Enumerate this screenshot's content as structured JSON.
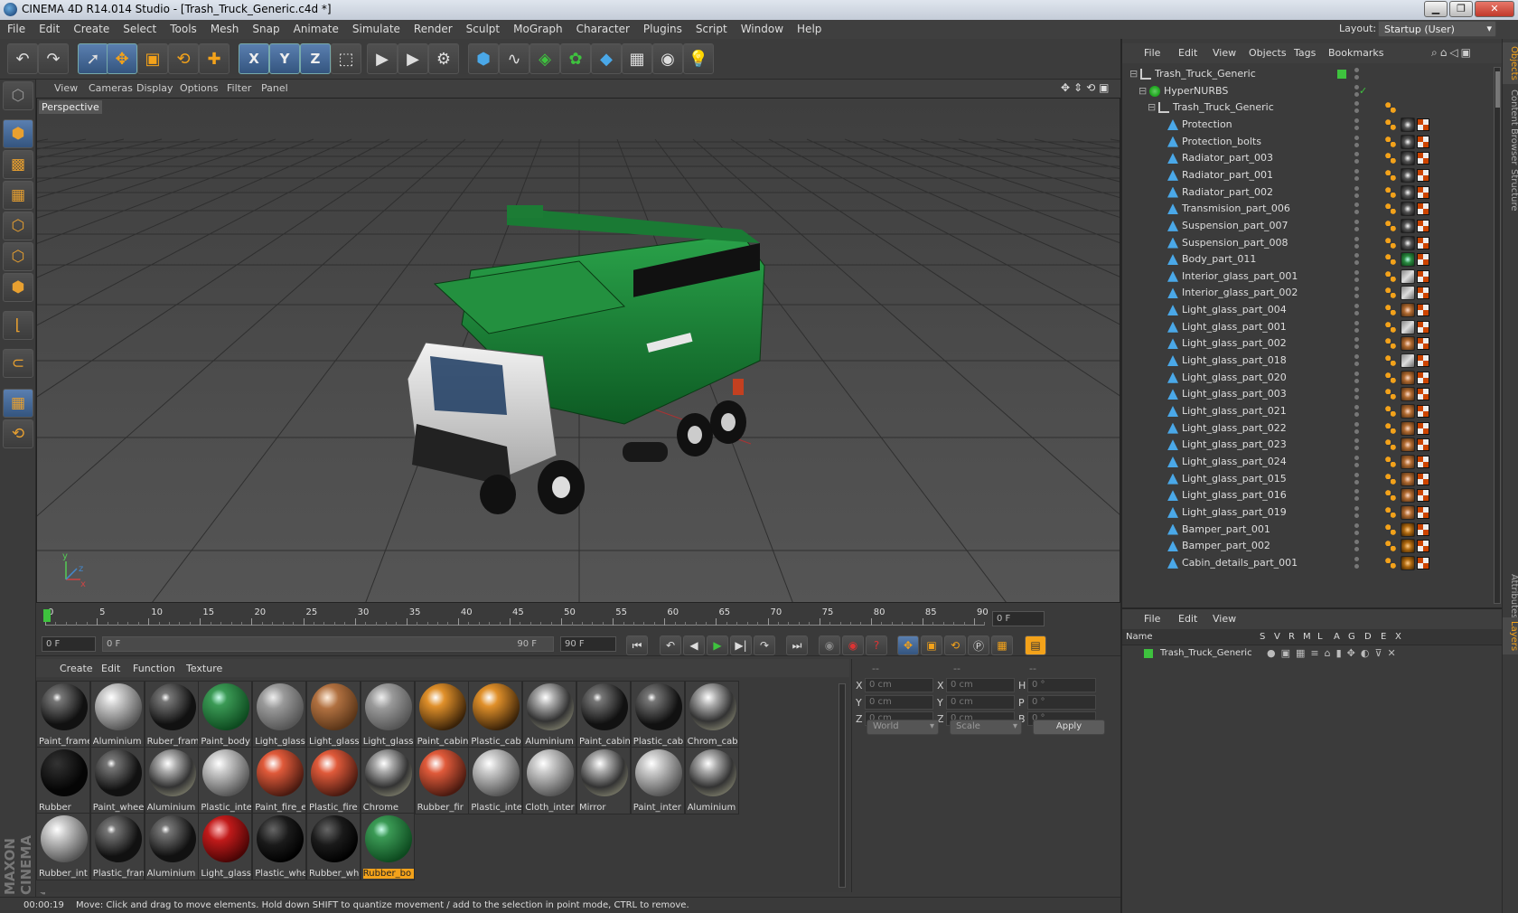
{
  "window": {
    "title": "CINEMA 4D R14.014 Studio - [Trash_Truck_Generic.c4d *]",
    "minimize": "▁",
    "maximize": "❐",
    "close": "✕"
  },
  "menubar": [
    "File",
    "Edit",
    "Create",
    "Select",
    "Tools",
    "Mesh",
    "Snap",
    "Animate",
    "Simulate",
    "Render",
    "Sculpt",
    "MoGraph",
    "Character",
    "Plugins",
    "Script",
    "Window",
    "Help"
  ],
  "layout": {
    "label": "Layout:",
    "value": "Startup (User)"
  },
  "toolbar": {
    "icons": [
      "undo-icon",
      "redo-icon",
      "live-selection-icon",
      "move-icon",
      "scale-icon",
      "rotate-icon",
      "recent-tool-icon",
      "x-axis-icon",
      "y-axis-icon",
      "z-axis-icon",
      "coordinate-system-icon",
      "render-view-icon",
      "render-picture-viewer-icon",
      "render-settings-icon",
      "cube-icon",
      "spline-icon",
      "nurbs-icon",
      "array-icon",
      "deformer-icon",
      "floor-icon",
      "camera-icon",
      "light-icon"
    ],
    "axis_labels": [
      "X",
      "Y",
      "Z"
    ]
  },
  "left_tools": [
    "make-editable-icon",
    "model-mode-icon",
    "texture-mode-icon",
    "workplane-mode-icon",
    "points-mode-icon",
    "edges-mode-icon",
    "polygons-mode-icon",
    "enable-axis-icon",
    "tweak-icon",
    "snap-icon",
    "lock-workplane-icon"
  ],
  "brand": "MAXON CINEMA 4D",
  "viewport": {
    "menu": [
      "View",
      "Cameras",
      "Display",
      "Options",
      "Filter",
      "Panel"
    ],
    "label": "Perspective",
    "axis_letters": {
      "x": "x",
      "y": "y",
      "z": "z"
    }
  },
  "timeline": {
    "ticks": [
      "0",
      "5",
      "10",
      "15",
      "20",
      "25",
      "30",
      "35",
      "40",
      "45",
      "50",
      "55",
      "60",
      "65",
      "70",
      "75",
      "80",
      "85",
      "90"
    ],
    "current_frame": "0 F",
    "start": "0 F",
    "range_start": "0 F",
    "range_end": "90 F",
    "end": "90 F"
  },
  "material_panel": {
    "menu": [
      "Create",
      "Edit",
      "Function",
      "Texture"
    ],
    "materials": [
      {
        "name": "Paint_frame",
        "style": "checker-dark"
      },
      {
        "name": "Aluminium",
        "style": "checker-light"
      },
      {
        "name": "Ruber_frame",
        "style": "checker-dark"
      },
      {
        "name": "Paint_body",
        "style": "green"
      },
      {
        "name": "Light_glass",
        "style": "glass"
      },
      {
        "name": "Light_glass",
        "style": "amber"
      },
      {
        "name": "Light_glass",
        "style": "glass"
      },
      {
        "name": "Paint_cabin",
        "style": "orange-checker"
      },
      {
        "name": "Plastic_cab",
        "style": "orange-checker"
      },
      {
        "name": "Aluminium",
        "style": "chrome"
      },
      {
        "name": "Paint_cabin",
        "style": "checker-dark"
      },
      {
        "name": "Plastic_cab",
        "style": "checker-dark"
      },
      {
        "name": "Chrom_cab",
        "style": "chrome"
      },
      {
        "name": "Rubber",
        "style": "black"
      },
      {
        "name": "Paint_wheel",
        "style": "checker-dark"
      },
      {
        "name": "Aluminium",
        "style": "chrome"
      },
      {
        "name": "Plastic_inte",
        "style": "checker-light"
      },
      {
        "name": "Paint_fire_e",
        "style": "red-checker"
      },
      {
        "name": "Plastic_fire",
        "style": "red-checker"
      },
      {
        "name": "Chrome",
        "style": "chrome"
      },
      {
        "name": "Rubber_fir",
        "style": "red-checker"
      },
      {
        "name": "Plastic_inte",
        "style": "checker-light"
      },
      {
        "name": "Cloth_inter",
        "style": "checker-light"
      },
      {
        "name": "Mirror",
        "style": "chrome"
      },
      {
        "name": "Paint_inter",
        "style": "checker-light"
      },
      {
        "name": "Aluminium",
        "style": "chrome"
      },
      {
        "name": "Rubber_int",
        "style": "checker-light"
      },
      {
        "name": "Plastic_fran",
        "style": "checker-dark"
      },
      {
        "name": "Aluminium",
        "style": "checker-dark"
      },
      {
        "name": "Light_glass",
        "style": "red"
      },
      {
        "name": "Plastic_whe",
        "style": "black-checker"
      },
      {
        "name": "Rubber_wh",
        "style": "black-checker"
      },
      {
        "name": "Rubber_bo",
        "style": "green",
        "selected": true
      }
    ]
  },
  "coords": {
    "headers": [
      "--",
      "--",
      "--"
    ],
    "rows": [
      {
        "a": "X",
        "av": "0 cm",
        "b": "X",
        "bv": "0 cm",
        "c": "H",
        "cv": "0 °"
      },
      {
        "a": "Y",
        "av": "0 cm",
        "b": "Y",
        "bv": "0 cm",
        "c": "P",
        "cv": "0 °"
      },
      {
        "a": "Z",
        "av": "0 cm",
        "b": "Z",
        "bv": "0 cm",
        "c": "B",
        "cv": "0 °"
      }
    ],
    "mode": "World",
    "scale": "Scale",
    "apply": "Apply"
  },
  "status": {
    "time": "00:00:19",
    "message": "Move: Click and drag to move elements. Hold down SHIFT to quantize movement / add to the selection in point mode, CTRL to remove."
  },
  "objects_panel": {
    "menu": [
      "File",
      "Edit",
      "View",
      "Objects",
      "Tags",
      "Bookmarks"
    ],
    "tree": [
      {
        "name": "Trash_Truck_Generic",
        "depth": 0,
        "type": "null"
      },
      {
        "name": "HyperNURBS",
        "depth": 1,
        "type": "nurbs"
      },
      {
        "name": "Trash_Truck_Generic",
        "depth": 2,
        "type": "null"
      },
      {
        "name": "Protection",
        "depth": 3,
        "type": "poly",
        "mat": "chrome"
      },
      {
        "name": "Protection_bolts",
        "depth": 3,
        "type": "poly",
        "mat": "chrome"
      },
      {
        "name": "Radiator_part_003",
        "depth": 3,
        "type": "poly",
        "mat": "chrome"
      },
      {
        "name": "Radiator_part_001",
        "depth": 3,
        "type": "poly",
        "mat": "chrome"
      },
      {
        "name": "Radiator_part_002",
        "depth": 3,
        "type": "poly",
        "mat": "chrome"
      },
      {
        "name": "Transmision_part_006",
        "depth": 3,
        "type": "poly",
        "mat": "chrome"
      },
      {
        "name": "Suspension_part_007",
        "depth": 3,
        "type": "poly",
        "mat": "chrome"
      },
      {
        "name": "Suspension_part_008",
        "depth": 3,
        "type": "poly",
        "mat": "chrome"
      },
      {
        "name": "Body_part_011",
        "depth": 3,
        "type": "poly",
        "mat": "green"
      },
      {
        "name": "Interior_glass_part_001",
        "depth": 3,
        "type": "poly",
        "mat": "glass"
      },
      {
        "name": "Interior_glass_part_002",
        "depth": 3,
        "type": "poly",
        "mat": "glass"
      },
      {
        "name": "Light_glass_part_004",
        "depth": 3,
        "type": "poly",
        "mat": "amber"
      },
      {
        "name": "Light_glass_part_001",
        "depth": 3,
        "type": "poly",
        "mat": "glass"
      },
      {
        "name": "Light_glass_part_002",
        "depth": 3,
        "type": "poly",
        "mat": "amber"
      },
      {
        "name": "Light_glass_part_018",
        "depth": 3,
        "type": "poly",
        "mat": "glass"
      },
      {
        "name": "Light_glass_part_020",
        "depth": 3,
        "type": "poly",
        "mat": "amber"
      },
      {
        "name": "Light_glass_part_003",
        "depth": 3,
        "type": "poly",
        "mat": "amber"
      },
      {
        "name": "Light_glass_part_021",
        "depth": 3,
        "type": "poly",
        "mat": "amber"
      },
      {
        "name": "Light_glass_part_022",
        "depth": 3,
        "type": "poly",
        "mat": "amber"
      },
      {
        "name": "Light_glass_part_023",
        "depth": 3,
        "type": "poly",
        "mat": "amber"
      },
      {
        "name": "Light_glass_part_024",
        "depth": 3,
        "type": "poly",
        "mat": "amber"
      },
      {
        "name": "Light_glass_part_015",
        "depth": 3,
        "type": "poly",
        "mat": "amber"
      },
      {
        "name": "Light_glass_part_016",
        "depth": 3,
        "type": "poly",
        "mat": "amber"
      },
      {
        "name": "Light_glass_part_019",
        "depth": 3,
        "type": "poly",
        "mat": "amber"
      },
      {
        "name": "Bamper_part_001",
        "depth": 3,
        "type": "poly",
        "mat": "orange"
      },
      {
        "name": "Bamper_part_002",
        "depth": 3,
        "type": "poly",
        "mat": "orange"
      },
      {
        "name": "Cabin_details_part_001",
        "depth": 3,
        "type": "poly",
        "mat": "orange"
      }
    ]
  },
  "side_tabs": [
    "Objects",
    "Content Browser",
    "Structure",
    "Attributes",
    "Layers"
  ],
  "layers_panel": {
    "menu": [
      "File",
      "Edit",
      "View"
    ],
    "columns": [
      "Name",
      "S",
      "V",
      "R",
      "M",
      "L",
      "A",
      "G",
      "D",
      "E",
      "X"
    ],
    "rows": [
      {
        "name": "Trash_Truck_Generic",
        "color": "#3ec23e"
      }
    ]
  },
  "colors": {
    "accent": "#f3a21a",
    "selection_blue": "#34557f",
    "truck_green": "#1e8a3a"
  }
}
